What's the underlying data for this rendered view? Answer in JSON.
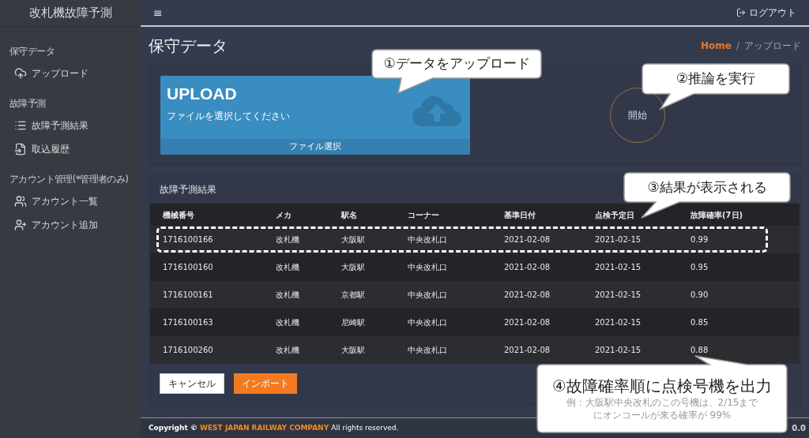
{
  "sidebar": {
    "brand": "改札機故障予測",
    "sections": [
      {
        "heading": "保守データ",
        "items": [
          {
            "label": "アップロード"
          }
        ]
      },
      {
        "heading": "故障予測",
        "items": [
          {
            "label": "故障予測結果"
          },
          {
            "label": "取込履歴"
          }
        ]
      },
      {
        "heading": "アカウント管理(*管理者のみ)",
        "items": [
          {
            "label": "アカウント一覧"
          },
          {
            "label": "アカウント追加"
          }
        ]
      }
    ]
  },
  "topbar": {
    "menu_icon": "≡",
    "logout": "ログアウト"
  },
  "page": {
    "title": "保守データ",
    "breadcrumb": [
      "Home",
      "アップロード"
    ],
    "breadcrumb_separator": "/"
  },
  "upload": {
    "title": "UPLOAD",
    "hint": "ファイルを選択してください",
    "button": "ファイル選択"
  },
  "start_button": "開始",
  "results": {
    "title": "故障予測結果",
    "columns": [
      "機械番号",
      "メカ",
      "駅名",
      "コーナー",
      "基準日付",
      "点検予定日",
      "故障確率(7日)"
    ],
    "rows": [
      {
        "cells": [
          "1716100166",
          "改札機",
          "大阪駅",
          "中央改札口",
          "2021-02-08",
          "2021-02-15",
          "0.99"
        ],
        "highlighted": true
      },
      {
        "cells": [
          "1716100160",
          "改札機",
          "大阪駅",
          "中央改札口",
          "2021-02-08",
          "2021-02-15",
          "0.95"
        ],
        "highlighted": false
      },
      {
        "cells": [
          "1716100161",
          "改札機",
          "京都駅",
          "中央改札口",
          "2021-02-08",
          "2021-02-15",
          "0.90"
        ],
        "highlighted": false
      },
      {
        "cells": [
          "1716100163",
          "改札機",
          "尼崎駅",
          "中央改札口",
          "2021-02-08",
          "2021-02-15",
          "0.85"
        ],
        "highlighted": false
      },
      {
        "cells": [
          "1716100260",
          "改札機",
          "大阪駅",
          "中央改札口",
          "2021-02-08",
          "2021-02-15",
          "0.88"
        ],
        "highlighted": false
      }
    ],
    "buttons": [
      {
        "label": "キャンセル",
        "kind": "secondary"
      },
      {
        "label": "インポート",
        "kind": "primary"
      }
    ]
  },
  "footer": {
    "prefix": "Copyright ©",
    "company": "WEST JAPAN RAILWAY COMPANY",
    "suffix": "All rights reserved.",
    "version": "0.0"
  },
  "annotations": [
    {
      "title": "①データをアップロード"
    },
    {
      "title": "②推論を実行"
    },
    {
      "title": "③結果が表示される"
    },
    {
      "title": "④故障確率順に点検号機を出力",
      "note": [
        "例：大阪駅中央改札のこの号機は、2/15まで",
        "にオンコールが来る確率が 99%"
      ]
    }
  ]
}
